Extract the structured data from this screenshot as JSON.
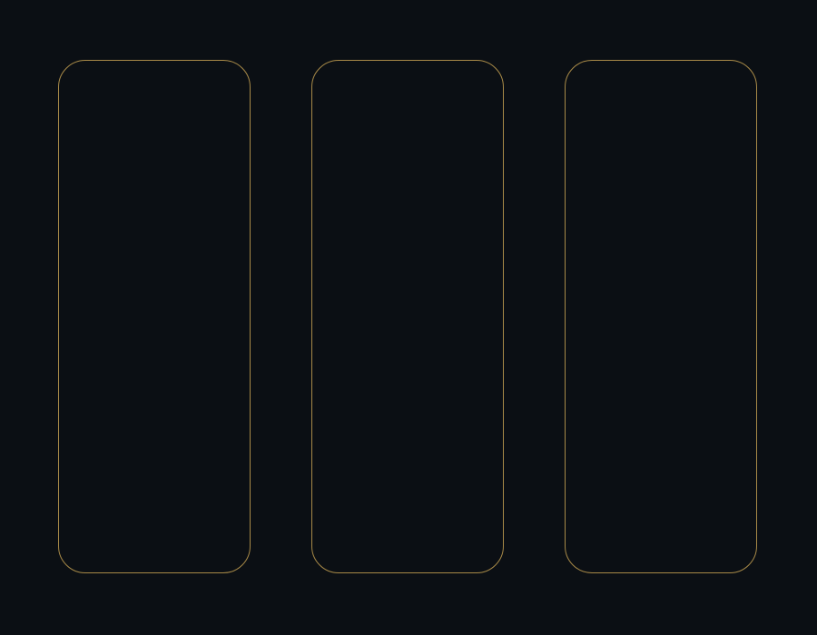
{
  "panels": [
    {
      "id": "panel-1",
      "label": ""
    },
    {
      "id": "panel-2",
      "label": ""
    },
    {
      "id": "panel-3",
      "label": ""
    }
  ],
  "colors": {
    "background": "#0b0f14",
    "panel_border": "#a88a48"
  }
}
